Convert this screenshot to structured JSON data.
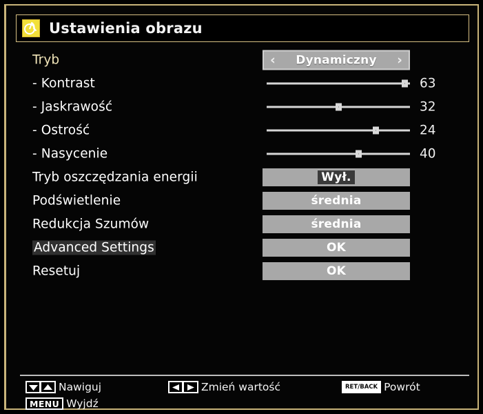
{
  "window": {
    "title": "Ustawienia obrazu",
    "icon": "picture-settings-icon",
    "border_color": "#c9b47a",
    "background_color": "#050505"
  },
  "colors": {
    "selected_label": "#f0e4b8",
    "label": "#ffffff",
    "value_box": "#a8a8a8",
    "slider_track": "#d6d6d6",
    "title_icon": "#f2e03a"
  },
  "menu": {
    "rows": [
      {
        "label": "Tryb",
        "type": "select",
        "value": "Dynamiczny",
        "selected": true,
        "left_chevron": "‹",
        "right_chevron": "›"
      },
      {
        "label": "- Kontrast",
        "type": "slider",
        "value": "63",
        "percent": 96,
        "selected": false
      },
      {
        "label": "- Jaskrawość",
        "type": "slider",
        "value": "32",
        "percent": 50,
        "selected": false
      },
      {
        "label": "- Ostrość",
        "type": "slider",
        "value": "24",
        "percent": 76,
        "selected": false
      },
      {
        "label": "- Nasycenie",
        "type": "slider",
        "value": "40",
        "percent": 64,
        "selected": false
      },
      {
        "label": "Tryb oszczędzania energii",
        "type": "option",
        "value": "Wył.",
        "value_highlighted": true,
        "selected": false
      },
      {
        "label": "Podświetlenie",
        "type": "option",
        "value": "średnia",
        "value_highlighted": false,
        "selected": false
      },
      {
        "label": "Redukcja Szumów",
        "type": "option",
        "value": "średnia",
        "value_highlighted": false,
        "selected": false
      },
      {
        "label": "Advanced Settings",
        "type": "action",
        "value": "OK",
        "label_highlighted": true,
        "selected": false
      },
      {
        "label": "Resetuj",
        "type": "action",
        "value": "OK",
        "label_highlighted": false,
        "selected": false
      }
    ]
  },
  "footer": {
    "hints": [
      {
        "keys": [
          "arrow-down",
          "arrow-up"
        ],
        "text": "Nawiguj"
      },
      {
        "keys": [
          "MENU"
        ],
        "text": "Wyjdź"
      },
      {
        "keys": [
          "arrow-left",
          "arrow-right"
        ],
        "text": "Zmień wartość"
      },
      {
        "keys": [
          "RET/BACK"
        ],
        "text": "Powrót"
      }
    ],
    "menu_key_label": "MENU",
    "back_key_label": "RET/BACK"
  }
}
